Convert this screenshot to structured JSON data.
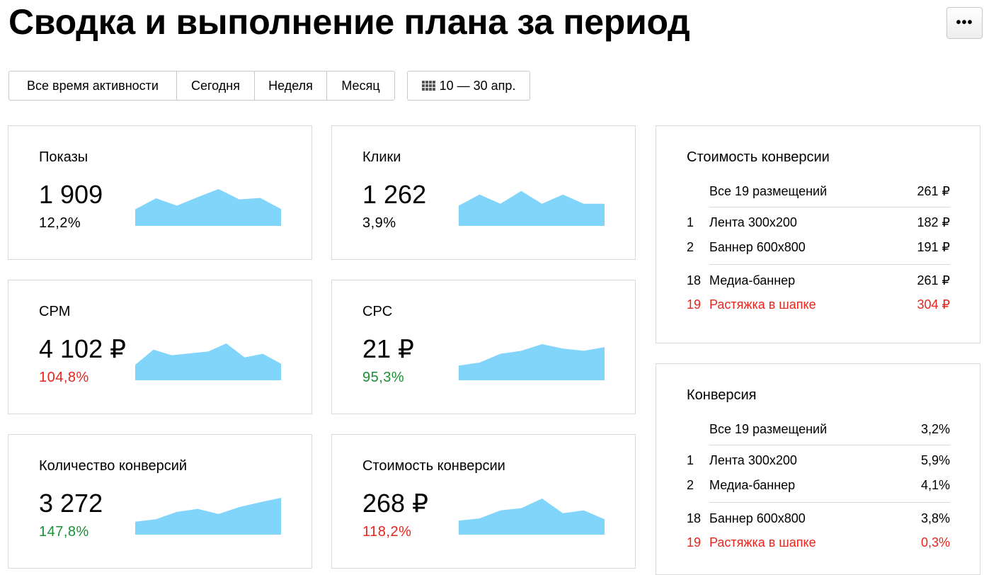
{
  "header": {
    "title": "Сводка и выполнение плана за период",
    "menu_label": "•••"
  },
  "periods": [
    "Все время активности",
    "Сегодня",
    "Неделя",
    "Месяц"
  ],
  "date_range": "10 — 30 апр.",
  "date_icon": "calendar-grid-icon",
  "chart_color": "#81d4fa",
  "metrics": [
    {
      "label": "Показы",
      "value": "1 909",
      "pct": "12,2%",
      "pct_color": "black",
      "trend": [
        0.45,
        0.75,
        0.55,
        0.78,
        1.0,
        0.72,
        0.76,
        0.46
      ]
    },
    {
      "label": "Клики",
      "value": "1 262",
      "pct": "3,9%",
      "pct_color": "black",
      "trend": [
        0.55,
        0.85,
        0.6,
        0.95,
        0.6,
        0.85,
        0.6,
        0.6
      ]
    },
    {
      "label": "CPM",
      "value": "4 102 ₽",
      "pct": "104,8%",
      "pct_color": "red",
      "trend": [
        0.42,
        0.83,
        0.68,
        0.73,
        0.78,
        1.0,
        0.62,
        0.72,
        0.45
      ]
    },
    {
      "label": "CPC",
      "value": "21 ₽",
      "pct": "95,3%",
      "pct_color": "green",
      "trend": [
        0.4,
        0.48,
        0.72,
        0.8,
        0.98,
        0.86,
        0.8,
        0.9
      ]
    },
    {
      "label": "Количество конверсий",
      "value": "3 272",
      "pct": "147,8%",
      "pct_color": "green",
      "trend": [
        0.35,
        0.42,
        0.62,
        0.7,
        0.56,
        0.75,
        0.88,
        1.0
      ]
    },
    {
      "label": "Стоимость конверсии",
      "value": "268 ₽",
      "pct": "118,2%",
      "pct_color": "red",
      "trend": [
        0.38,
        0.44,
        0.66,
        0.72,
        0.98,
        0.58,
        0.66,
        0.42
      ]
    }
  ],
  "panels": [
    {
      "title": "Стоимость конверсии",
      "total": {
        "name": "Все 19 размещений",
        "value": "261 ₽"
      },
      "top": [
        {
          "rank": "1",
          "name": "Лента 300x200",
          "value": "182 ₽"
        },
        {
          "rank": "2",
          "name": "Баннер 600x800",
          "value": "191 ₽"
        }
      ],
      "bottom": [
        {
          "rank": "18",
          "name": "Медиа-баннер",
          "value": "261 ₽",
          "color": "black"
        },
        {
          "rank": "19",
          "name": "Растяжка в шапке",
          "value": "304 ₽",
          "color": "red"
        }
      ]
    },
    {
      "title": "Конверсия",
      "total": {
        "name": "Все 19 размещений",
        "value": "3,2%"
      },
      "top": [
        {
          "rank": "1",
          "name": "Лента 300x200",
          "value": "5,9%"
        },
        {
          "rank": "2",
          "name": "Медиа-баннер",
          "value": "4,1%"
        }
      ],
      "bottom": [
        {
          "rank": "18",
          "name": "Баннер 600x800",
          "value": "3,8%",
          "color": "black"
        },
        {
          "rank": "19",
          "name": "Растяжка в шапке",
          "value": "0,3%",
          "color": "red"
        }
      ]
    }
  ]
}
